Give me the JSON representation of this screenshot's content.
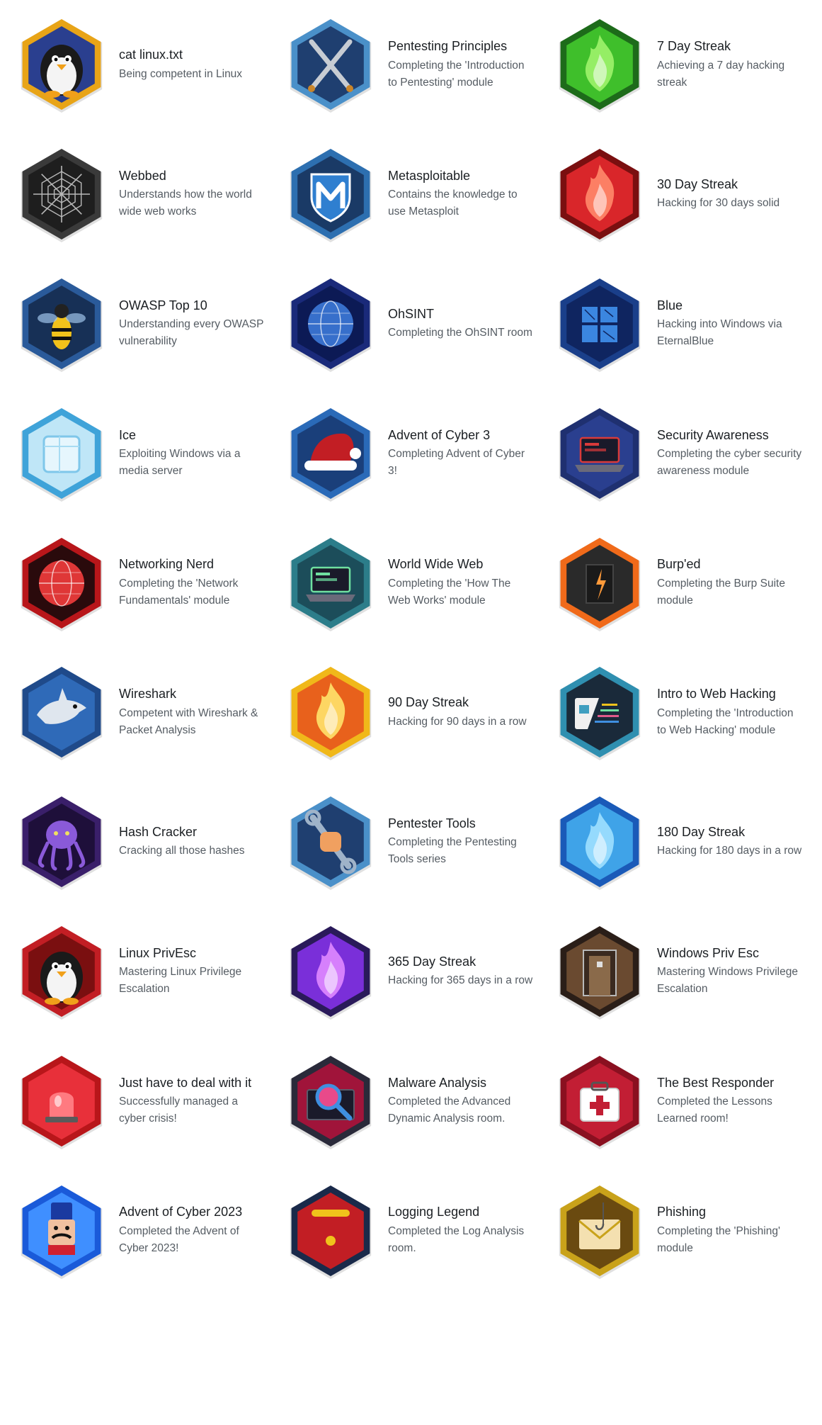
{
  "badges": [
    {
      "title": "cat linux.txt",
      "desc": "Being competent in Linux",
      "icon": "penguin-icon",
      "outer": "#e8a417",
      "inner": "#2a3f8f",
      "accent": "#f4f4f4"
    },
    {
      "title": "Pentesting Principles",
      "desc": "Completing the 'Introduction to Pentesting' module",
      "icon": "crossed-swords-icon",
      "outer": "#4a90c9",
      "inner": "#1f3f70",
      "accent": "#c7ccd3"
    },
    {
      "title": "7 Day Streak",
      "desc": "Achieving a 7 day hacking streak",
      "icon": "green-flame-icon",
      "outer": "#1d6b1a",
      "inner": "#3fbf2b",
      "accent": "#9ef36b"
    },
    {
      "title": "Webbed",
      "desc": "Understands how the world wide web works",
      "icon": "spider-web-icon",
      "outer": "#3a3a3a",
      "inner": "#1e1e1e",
      "accent": "#b9b9b9"
    },
    {
      "title": "Metasploitable",
      "desc": "Contains the knowledge to use Metasploit",
      "icon": "metasploit-shield-icon",
      "outer": "#2d6fb0",
      "inner": "#1a3a66",
      "accent": "#ffffff"
    },
    {
      "title": "30 Day Streak",
      "desc": "Hacking for 30 days solid",
      "icon": "red-flame-icon",
      "outer": "#7a0f10",
      "inner": "#d9262a",
      "accent": "#ff8a6a"
    },
    {
      "title": "OWASP Top 10",
      "desc": "Understanding every OWASP vulnerability",
      "icon": "wasp-icon",
      "outer": "#2a5a9a",
      "inner": "#173056",
      "accent": "#f2c21b"
    },
    {
      "title": "OhSINT",
      "desc": "Completing the OhSINT room",
      "icon": "globe-icon",
      "outer": "#1a2a7a",
      "inner": "#0c1a55",
      "accent": "#3f7fe0"
    },
    {
      "title": "Blue",
      "desc": "Hacking into Windows via EternalBlue",
      "icon": "windows-cracked-icon",
      "outer": "#1a3f8a",
      "inner": "#0f2560",
      "accent": "#3b86e0"
    },
    {
      "title": "Ice",
      "desc": "Exploiting Windows via a media server",
      "icon": "ice-cube-icon",
      "outer": "#3fa3d9",
      "inner": "#bfe6f7",
      "accent": "#ffffff"
    },
    {
      "title": "Advent of Cyber 3",
      "desc": "Completing Advent of Cyber 3!",
      "icon": "santa-hat-icon",
      "outer": "#2a6ab8",
      "inner": "#1a3f7a",
      "accent": "#c21e24"
    },
    {
      "title": "Security Awareness",
      "desc": "Completing the cyber security awareness module",
      "icon": "laptop-alert-icon",
      "outer": "#1f3070",
      "inner": "#2a3f8f",
      "accent": "#d93a3a"
    },
    {
      "title": "Networking Nerd",
      "desc": "Completing the 'Network Fundamentals' module",
      "icon": "network-orb-icon",
      "outer": "#b8161a",
      "inner": "#2a0a0c",
      "accent": "#ff4040"
    },
    {
      "title": "World Wide Web",
      "desc": "Completing the 'How The Web Works' module",
      "icon": "laptop-web-icon",
      "outer": "#2c7d8a",
      "inner": "#1c4d5a",
      "accent": "#6fe0a0"
    },
    {
      "title": "Burp'ed",
      "desc": "Completing the Burp Suite module",
      "icon": "burp-suite-icon",
      "outer": "#f06a1a",
      "inner": "#2a2a2a",
      "accent": "#ff9a3a"
    },
    {
      "title": "Wireshark",
      "desc": "Competent with Wireshark & Packet Analysis",
      "icon": "shark-icon",
      "outer": "#1f4a8a",
      "inner": "#2f6ab8",
      "accent": "#dfe6ee"
    },
    {
      "title": "90 Day Streak",
      "desc": "Hacking for 90 days in a row",
      "icon": "orange-flame-icon",
      "outer": "#f0b81a",
      "inner": "#e8611c",
      "accent": "#ffe36b"
    },
    {
      "title": "Intro to Web Hacking",
      "desc": "Completing the 'Introduction to Web Hacking' module",
      "icon": "web-code-icon",
      "outer": "#2f8fb0",
      "inner": "#1a2a3a",
      "accent": "#f0f0f0"
    },
    {
      "title": "Hash Cracker",
      "desc": "Cracking all those hashes",
      "icon": "kraken-icon",
      "outer": "#3a1f6a",
      "inner": "#1e0f3a",
      "accent": "#8a5ad9"
    },
    {
      "title": "Pentester Tools",
      "desc": "Completing the Pentesting Tools series",
      "icon": "fist-wrench-icon",
      "outer": "#4a90c9",
      "inner": "#1f3f70",
      "accent": "#f0a060"
    },
    {
      "title": "180 Day Streak",
      "desc": "Hacking for 180 days in a row",
      "icon": "blue-flame-icon",
      "outer": "#1a5ab8",
      "inner": "#3fa3e8",
      "accent": "#9fe0ff"
    },
    {
      "title": "Linux PrivEsc",
      "desc": "Mastering Linux Privilege Escalation",
      "icon": "penguin-crown-icon",
      "outer": "#c21e24",
      "inner": "#7a0f10",
      "accent": "#f4f4f4"
    },
    {
      "title": "365 Day Streak",
      "desc": "Hacking for 365 days in a row",
      "icon": "purple-flame-icon",
      "outer": "#2a1a5a",
      "inner": "#7a2fd9",
      "accent": "#e08aff"
    },
    {
      "title": "Windows Priv Esc",
      "desc": "Mastering Windows Privilege Escalation",
      "icon": "elevator-icon",
      "outer": "#2a1e18",
      "inner": "#6a4a30",
      "accent": "#b9b9b9"
    },
    {
      "title": "Just have to deal with it",
      "desc": "Successfully managed a cyber crisis!",
      "icon": "siren-icon",
      "outer": "#b8161a",
      "inner": "#e8303a",
      "accent": "#ff7a80"
    },
    {
      "title": "Malware Analysis",
      "desc": "Completed the Advanced Dynamic Analysis room.",
      "icon": "magnifier-malware-icon",
      "outer": "#2a2a3a",
      "inner": "#a0143a",
      "accent": "#3f8fe0"
    },
    {
      "title": "The Best Responder",
      "desc": "Completed the Lessons Learned room!",
      "icon": "first-aid-kit-icon",
      "outer": "#8a1020",
      "inner": "#c21e34",
      "accent": "#ffffff"
    },
    {
      "title": "Advent of Cyber 2023",
      "desc": "Completed the Advent of Cyber 2023!",
      "icon": "nutcracker-icon",
      "outer": "#1a5ad9",
      "inner": "#3f8fff",
      "accent": "#f0c0a0"
    },
    {
      "title": "Logging Legend",
      "desc": "Completed the Log Analysis room.",
      "icon": "log-scroll-icon",
      "outer": "#1a2a4a",
      "inner": "#c21e24",
      "accent": "#f0c21b"
    },
    {
      "title": "Phishing",
      "desc": "Completing the 'Phishing' module",
      "icon": "phishing-envelope-icon",
      "outer": "#c9a21a",
      "inner": "#6a4a10",
      "accent": "#f4e0b0"
    }
  ]
}
